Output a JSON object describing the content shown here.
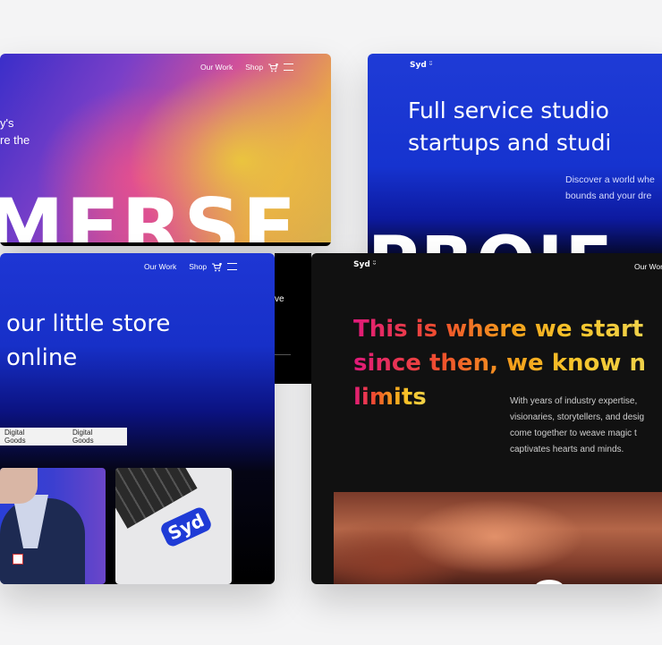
{
  "card1": {
    "nav": {
      "our_work": "Our Work",
      "shop": "Shop"
    },
    "intro_line1": "y's",
    "intro_line2": "re the",
    "big_word": "MERSE",
    "partial_text": "ve"
  },
  "card2": {
    "logo": "Syd",
    "headline_line1": "Full service studio",
    "headline_line2": "startups and studi",
    "sub_line1": "Discover a world whe",
    "sub_line2": "bounds and your dre",
    "big_word": "PROJE"
  },
  "card3": {
    "nav": {
      "our_work": "Our Work",
      "shop": "Shop"
    },
    "headline_line1": "our little store",
    "headline_line2": "online",
    "tabs": [
      "Digital Goods",
      "Digital Goods"
    ],
    "sticker_logo": "Syd"
  },
  "card4": {
    "logo": "Syd",
    "nav": {
      "our_work": "Our Work"
    },
    "headline_line1": "This is where we start",
    "headline_line2": "since then, we know n",
    "headline_line3": "limits",
    "body_line1": "With years of industry expertise,",
    "body_line2": "visionaries, storytellers, and desig",
    "body_line3": "come together to weave magic t",
    "body_line4": "captivates hearts and minds."
  },
  "colors": {
    "page_bg": "#f4f4f5",
    "brand_blue": "#1e36d4",
    "dark_card": "#111111",
    "gradient_pink": "#e0197b",
    "gradient_yellow": "#f6c42a"
  }
}
